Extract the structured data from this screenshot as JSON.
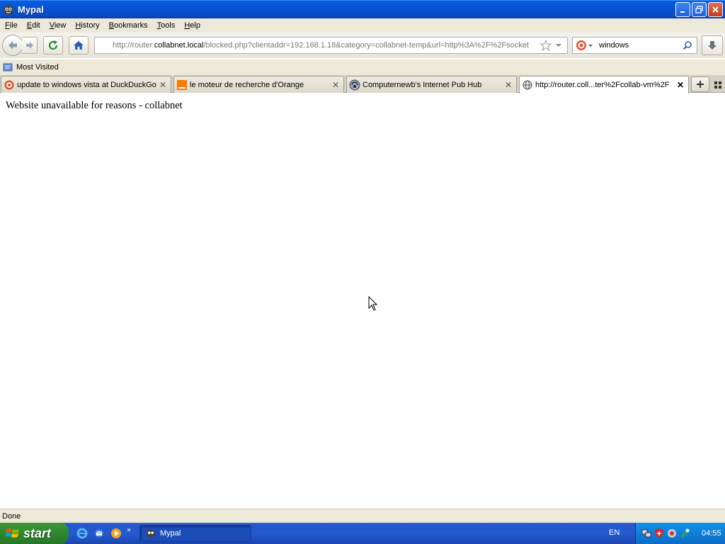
{
  "window": {
    "title": "Mypal"
  },
  "menu": [
    {
      "label": "File",
      "key": "F",
      "rest": "ile"
    },
    {
      "label": "Edit",
      "key": "E",
      "rest": "dit"
    },
    {
      "label": "View",
      "key": "V",
      "rest": "iew"
    },
    {
      "label": "History",
      "key": "H",
      "rest": "istory"
    },
    {
      "label": "Bookmarks",
      "key": "B",
      "rest": "ookmarks"
    },
    {
      "label": "Tools",
      "key": "T",
      "rest": "ools"
    },
    {
      "label": "Help",
      "key": "H",
      "rest": "elp"
    }
  ],
  "address": {
    "prefix": "http://router.",
    "host": "collabnet.local",
    "path": "/blocked.php?clientaddr=192.168.1.18&category=collabnet-temp&url=http%3A%2F%2Fsocket"
  },
  "search": {
    "value": "windows"
  },
  "bookmarks": {
    "most_visited": "Most Visited"
  },
  "tabs": [
    {
      "label": "update to windows vista at DuckDuckGo",
      "icon": "duckduckgo-icon",
      "active": false
    },
    {
      "label": "le moteur de recherche d'Orange",
      "icon": "orange-icon",
      "active": false
    },
    {
      "label": "Computernewb's Internet Pub Hub",
      "icon": "computernewb-icon",
      "active": false
    },
    {
      "label": "http://router.coll...ter%2Fcollab-vm%2F",
      "icon": "globe-icon",
      "active": true
    }
  ],
  "page": {
    "text": "Website unavailable for reasons - collabnet"
  },
  "status": {
    "text": "Done"
  },
  "taskbar": {
    "start_label": "start",
    "task_label": "Mypal",
    "language": "EN",
    "clock": "04:55"
  },
  "colors": {
    "titlebar": "#0553d6",
    "chrome": "#ece9d8",
    "taskbar": "#245ad0",
    "start": "#2f8a2f",
    "tray": "#0f7fd9"
  }
}
